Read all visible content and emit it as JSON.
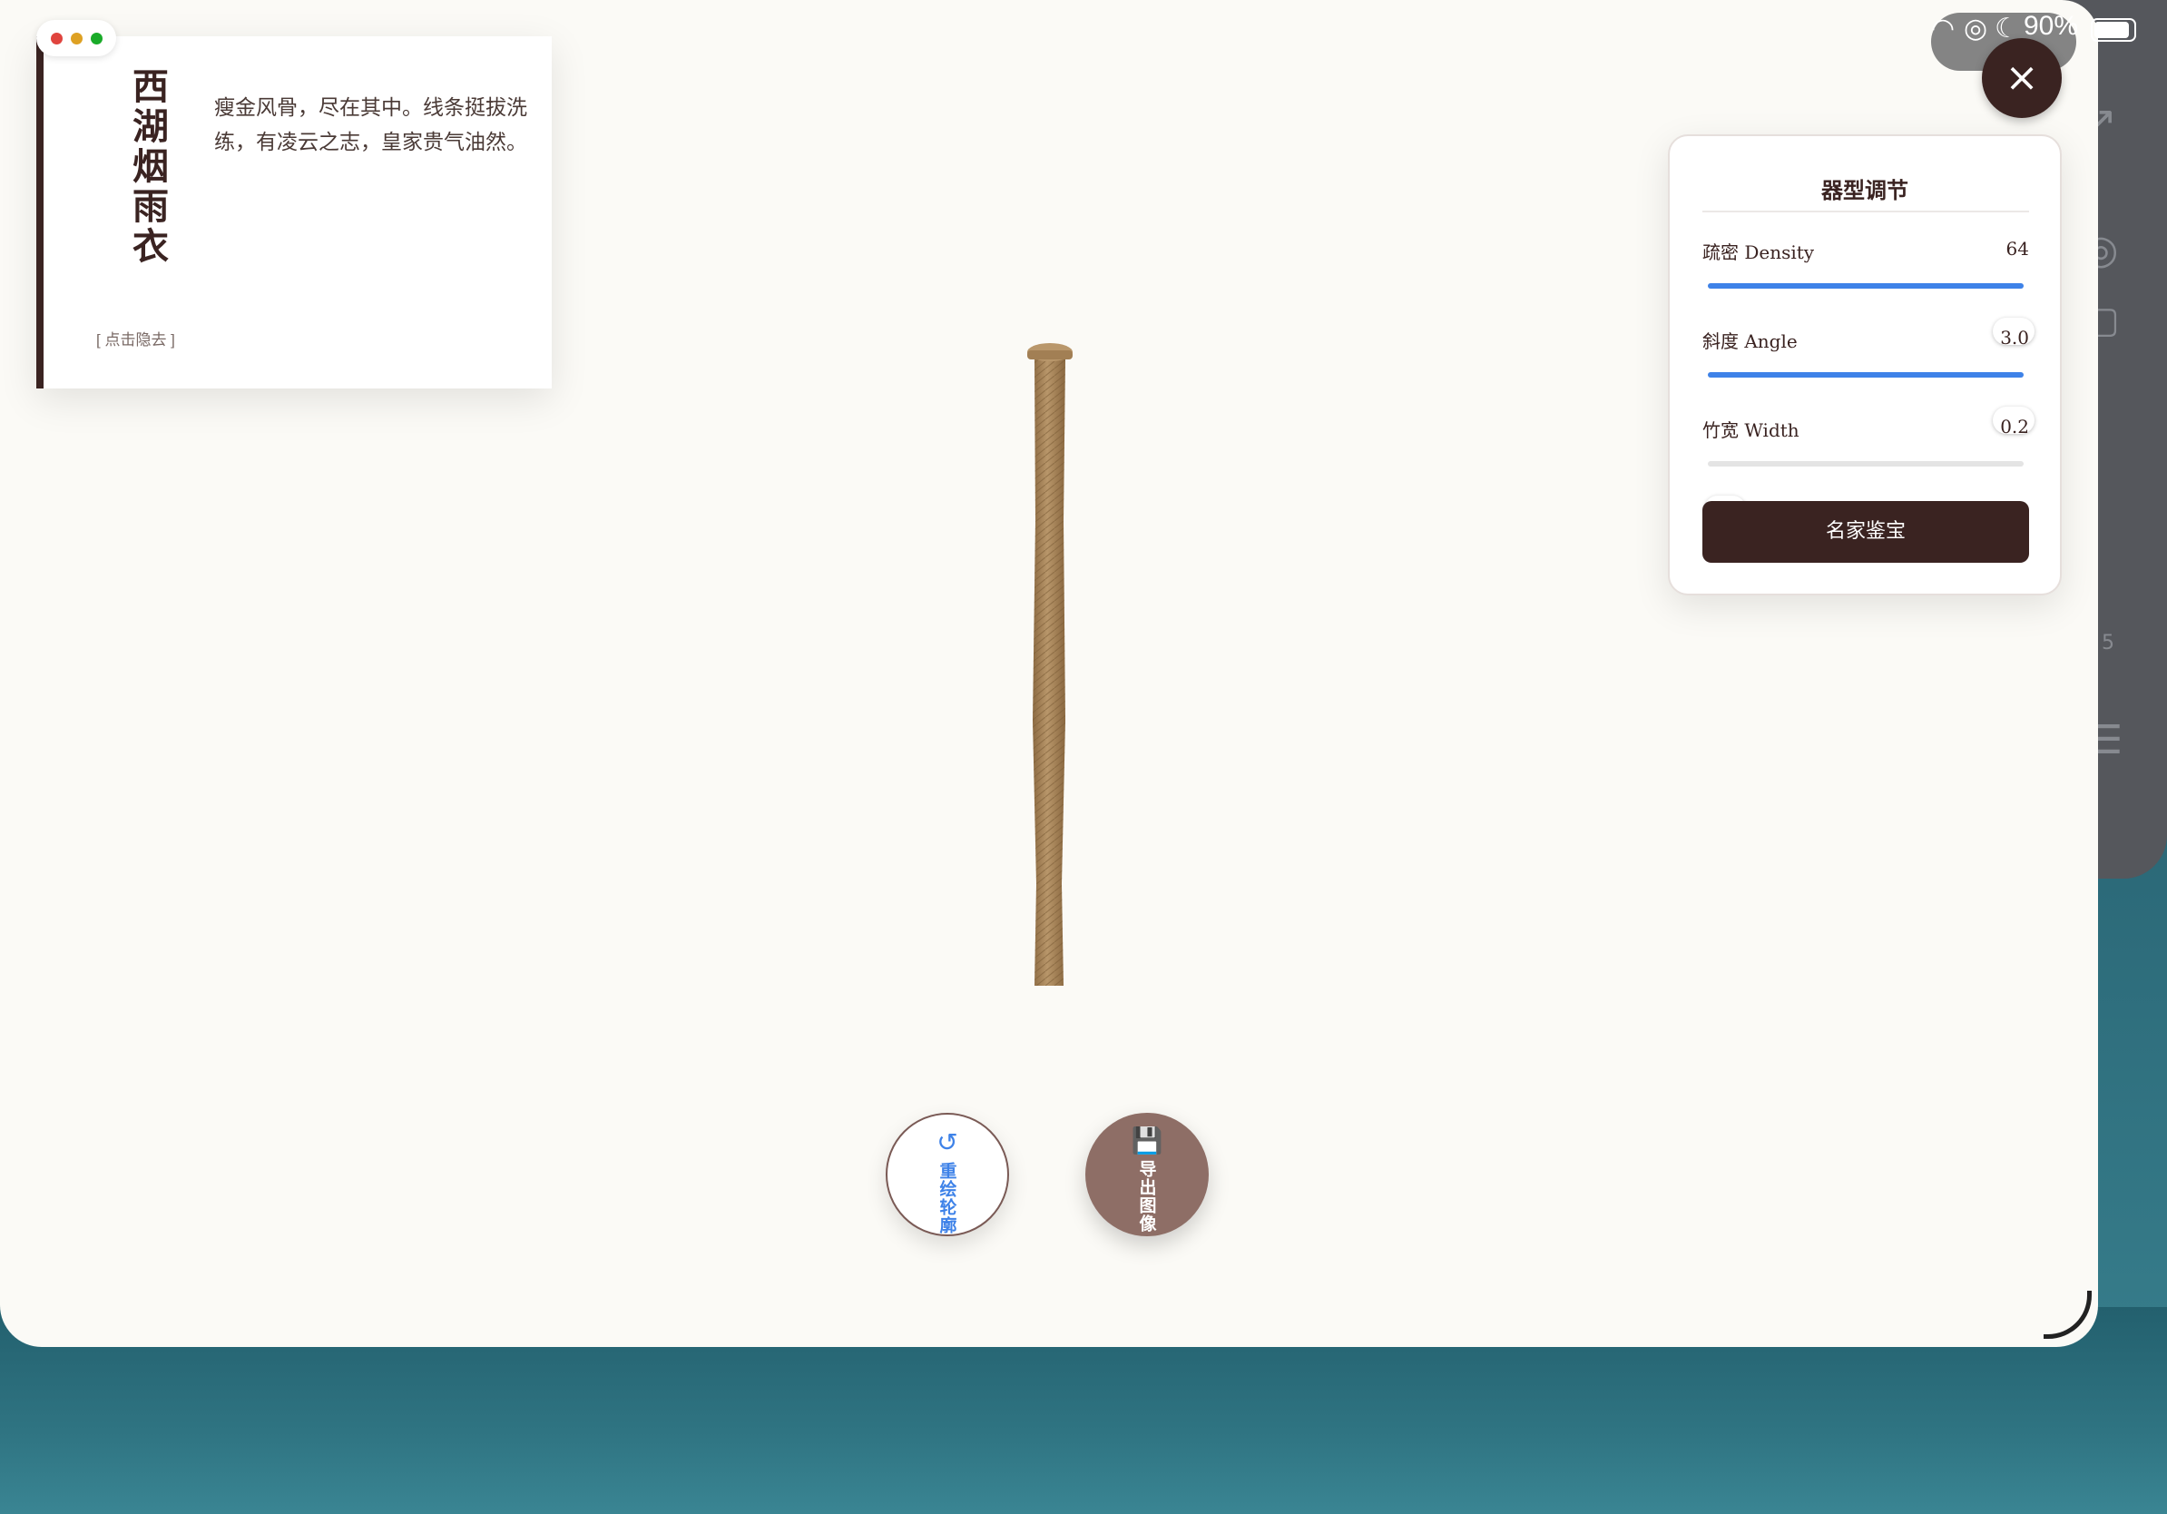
{
  "status": {
    "battery_text": "90%"
  },
  "window": {
    "close_label": "×"
  },
  "intro": {
    "title": "西湖烟雨衣",
    "description": "瘦金风骨，尽在其中。线条挺拔洗练，有凌云之志，皇家贵气油然。",
    "hide_link": "[ 点击隐去 ]"
  },
  "panel": {
    "title": "器型调节",
    "sliders": [
      {
        "label": "疏密 Density",
        "value_text": "64",
        "fraction": 1.0
      },
      {
        "label": "斜度 Angle",
        "value_text": "3.0",
        "fraction": 1.0
      },
      {
        "label": "竹宽 Width",
        "value_text": "0.2",
        "fraction": 0.0
      }
    ],
    "action_label": "名家鉴宝"
  },
  "actions": {
    "redraw_icon": "refresh-icon",
    "redraw_glyph": "↺",
    "redraw_label": "重绘轮廓",
    "export_icon": "floppy-disk-icon",
    "export_glyph": "💾",
    "export_label": "导出图像"
  },
  "background_app": {
    "mark_text": "5"
  },
  "colors": {
    "accent_dark": "#3a2321",
    "slider_blue": "#3e82e8",
    "export_brown": "#8e6e66",
    "bamboo": "#a7855a"
  }
}
